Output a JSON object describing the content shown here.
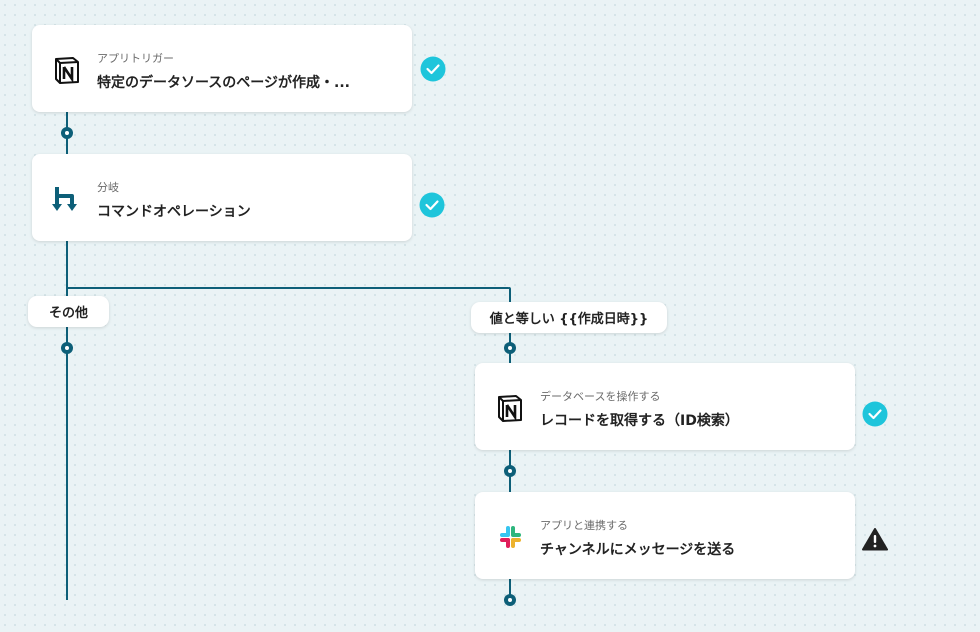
{
  "flow": {
    "steps": [
      {
        "subtitle": "アプリトリガー",
        "title": "特定のデータソースのページが作成・...",
        "icon": "notion-icon",
        "status": "complete"
      },
      {
        "subtitle": "分岐",
        "title": "コマンドオペレーション",
        "icon": "branch-icon",
        "status": "complete"
      },
      {
        "subtitle": "データベースを操作する",
        "title": "レコードを取得する（ID検索）",
        "icon": "notion-icon",
        "status": "complete"
      },
      {
        "subtitle": "アプリと連携する",
        "title": "チャンネルにメッセージを送る",
        "icon": "slack-icon",
        "status": "warning"
      }
    ],
    "branches": {
      "other": "その他",
      "condition": "値と等しい {{作成日時}}"
    }
  },
  "colors": {
    "connector": "#0d5f78",
    "check": "#1ec5db",
    "warning": "#222222",
    "background": "#eaf3f5"
  }
}
